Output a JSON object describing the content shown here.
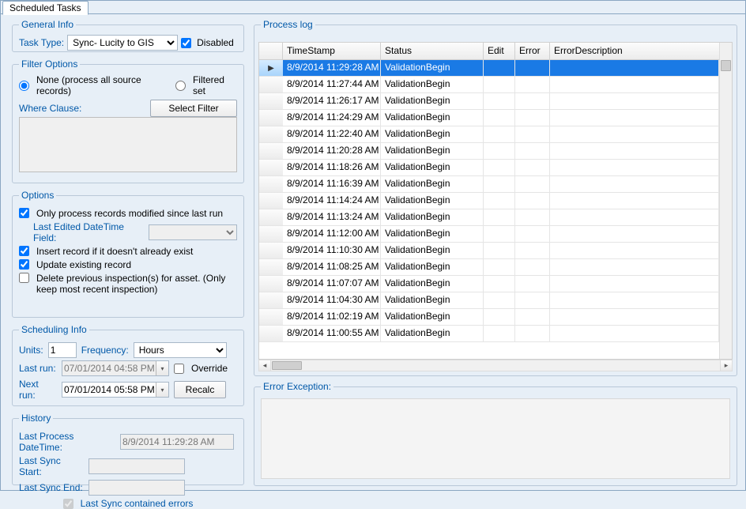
{
  "tabs": {
    "scheduled_tasks": "Scheduled Tasks"
  },
  "general": {
    "legend": "General Info",
    "task_type_label": "Task Type:",
    "task_type_value": "Sync- Lucity to GIS",
    "disabled_label": "Disabled",
    "disabled_checked": true
  },
  "filter": {
    "legend": "Filter Options",
    "opt_none": "None (process all source records)",
    "opt_filtered": "Filtered set",
    "selected": "none",
    "where_label": "Where Clause:",
    "select_filter_btn": "Select Filter",
    "where_value": ""
  },
  "options": {
    "legend": "Options",
    "modified_label": "Only process records modified since last run",
    "modified_checked": true,
    "last_edited_label": "Last Edited DateTime Field:",
    "last_edited_value": "",
    "insert_label": "Insert record if it doesn't already exist",
    "insert_checked": true,
    "update_label": "Update existing record",
    "update_checked": true,
    "delete_label": "Delete previous inspection(s) for asset.  (Only keep most recent inspection)",
    "delete_checked": false
  },
  "sched": {
    "legend": "Scheduling Info",
    "units_label": "Units:",
    "units_value": "1",
    "freq_label": "Frequency:",
    "freq_value": "Hours",
    "lastrun_label": "Last run:",
    "lastrun_value": "07/01/2014 04:58 PM",
    "override_label": "Override",
    "override_checked": false,
    "nextrun_label": "Next run:",
    "nextrun_value": "07/01/2014 05:58 PM",
    "recalc_btn": "Recalc"
  },
  "history": {
    "legend": "History",
    "lpdt_label": "Last Process DateTime:",
    "lpdt_value": "8/9/2014 11:29:28 AM",
    "lss_label": "Last Sync Start:",
    "lss_value": "",
    "lse_label": "Last Sync End:",
    "lse_value": "",
    "errs_label": "Last Sync contained errors",
    "errs_checked": true
  },
  "plog": {
    "legend": "Process log",
    "headers": {
      "ts": "TimeStamp",
      "status": "Status",
      "edit": "Edit",
      "error": "Error",
      "errdesc": "ErrorDescription"
    },
    "rows": [
      {
        "ts": "8/9/2014 11:29:28 AM",
        "status": "ValidationBegin",
        "edit": "",
        "error": "",
        "errdesc": ""
      },
      {
        "ts": "8/9/2014 11:27:44 AM",
        "status": "ValidationBegin",
        "edit": "",
        "error": "",
        "errdesc": ""
      },
      {
        "ts": "8/9/2014 11:26:17 AM",
        "status": "ValidationBegin",
        "edit": "",
        "error": "",
        "errdesc": ""
      },
      {
        "ts": "8/9/2014 11:24:29 AM",
        "status": "ValidationBegin",
        "edit": "",
        "error": "",
        "errdesc": ""
      },
      {
        "ts": "8/9/2014 11:22:40 AM",
        "status": "ValidationBegin",
        "edit": "",
        "error": "",
        "errdesc": ""
      },
      {
        "ts": "8/9/2014 11:20:28 AM",
        "status": "ValidationBegin",
        "edit": "",
        "error": "",
        "errdesc": ""
      },
      {
        "ts": "8/9/2014 11:18:26 AM",
        "status": "ValidationBegin",
        "edit": "",
        "error": "",
        "errdesc": ""
      },
      {
        "ts": "8/9/2014 11:16:39 AM",
        "status": "ValidationBegin",
        "edit": "",
        "error": "",
        "errdesc": ""
      },
      {
        "ts": "8/9/2014 11:14:24 AM",
        "status": "ValidationBegin",
        "edit": "",
        "error": "",
        "errdesc": ""
      },
      {
        "ts": "8/9/2014 11:13:24 AM",
        "status": "ValidationBegin",
        "edit": "",
        "error": "",
        "errdesc": ""
      },
      {
        "ts": "8/9/2014 11:12:00 AM",
        "status": "ValidationBegin",
        "edit": "",
        "error": "",
        "errdesc": ""
      },
      {
        "ts": "8/9/2014 11:10:30 AM",
        "status": "ValidationBegin",
        "edit": "",
        "error": "",
        "errdesc": ""
      },
      {
        "ts": "8/9/2014 11:08:25 AM",
        "status": "ValidationBegin",
        "edit": "",
        "error": "",
        "errdesc": ""
      },
      {
        "ts": "8/9/2014 11:07:07 AM",
        "status": "ValidationBegin",
        "edit": "",
        "error": "",
        "errdesc": ""
      },
      {
        "ts": "8/9/2014 11:04:30 AM",
        "status": "ValidationBegin",
        "edit": "",
        "error": "",
        "errdesc": ""
      },
      {
        "ts": "8/9/2014 11:02:19 AM",
        "status": "ValidationBegin",
        "edit": "",
        "error": "",
        "errdesc": ""
      },
      {
        "ts": "8/9/2014 11:00:55 AM",
        "status": "ValidationBegin",
        "edit": "",
        "error": "",
        "errdesc": ""
      }
    ],
    "selected_index": 0
  },
  "errex": {
    "legend": "Error Exception:",
    "value": ""
  }
}
